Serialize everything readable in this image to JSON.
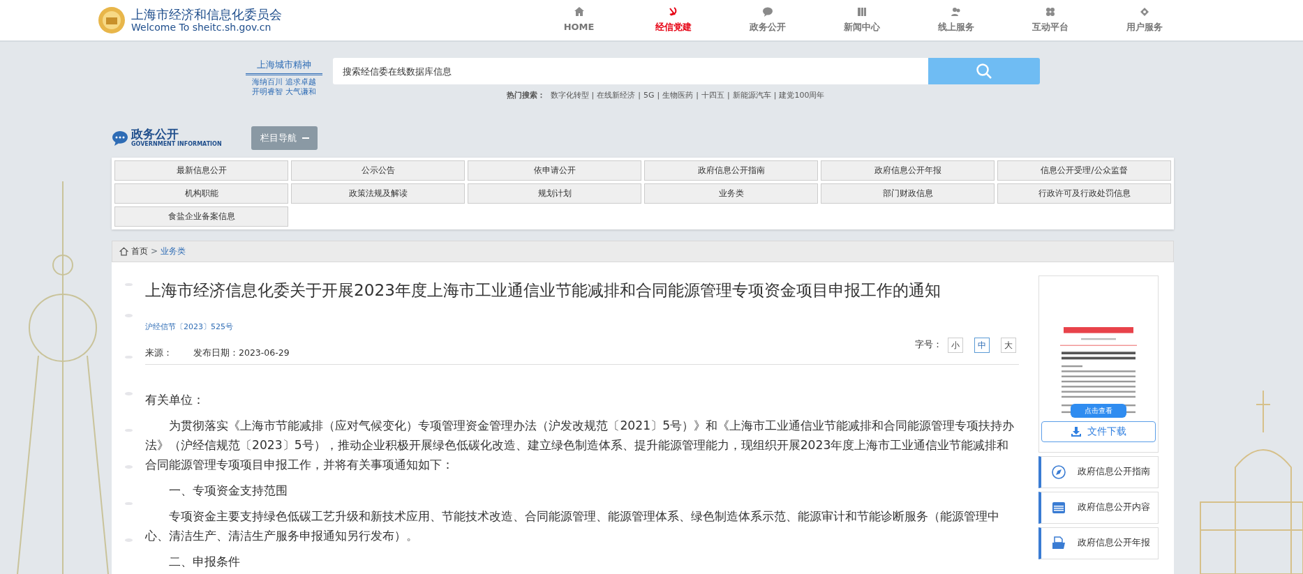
{
  "header": {
    "logo_title": "上海市经济和信息化委员会",
    "logo_subtitle": "Welcome To sheitc.sh.gov.cn",
    "nav": [
      {
        "label": "HOME",
        "selected": false
      },
      {
        "label": "经信党建",
        "selected": true
      },
      {
        "label": "政务公开",
        "selected": false
      },
      {
        "label": "新闻中心",
        "selected": false
      },
      {
        "label": "线上服务",
        "selected": false
      },
      {
        "label": "互动平台",
        "selected": false
      },
      {
        "label": "用户服务",
        "selected": false
      }
    ]
  },
  "search": {
    "motto_title": "上海城市精神",
    "motto_lines": [
      "海纳百川 追求卓越",
      "开明睿智 大气谦和"
    ],
    "placeholder": "搜索经信委在线数据库信息",
    "hot_label": "热门搜索：",
    "hot_separator": "|",
    "hot_terms": [
      "数字化转型",
      "在线新经济",
      "5G",
      "生物医药",
      "十四五",
      "新能源汽车",
      "建党100周年"
    ]
  },
  "section": {
    "title": "政务公开",
    "subtitle": "GOVERNMENT INFORMATION",
    "nav_toggle": "栏目导航"
  },
  "categories": [
    "最新信息公开",
    "公示公告",
    "依申请公开",
    "政府信息公开指南",
    "政府信息公开年报",
    "信息公开受理/公众监督",
    "机构职能",
    "政策法规及解读",
    "规划计划",
    "业务类",
    "部门财政信息",
    "行政许可及行政处罚信息",
    "食盐企业备案信息"
  ],
  "breadcrumb": {
    "items": [
      "首页",
      "业务类"
    ],
    "separator": ">"
  },
  "article": {
    "title": "上海市经济信息化委关于开展2023年度上海市工业通信业节能减排和合同能源管理专项资金项目申报工作的通知",
    "doc_number": "沪经信节〔2023〕525号",
    "source_label": "来源：",
    "date_label": "发布日期：2023-06-29",
    "font_size_label": "字号：",
    "font_sizes": [
      {
        "label": "小",
        "selected": false
      },
      {
        "label": "中",
        "selected": true
      },
      {
        "label": "大",
        "selected": false
      }
    ],
    "paragraphs": [
      {
        "kind": "salutation",
        "text": "有关单位："
      },
      {
        "kind": "body",
        "text": "为贯彻落实《上海市节能减排（应对气候变化）专项管理资金管理办法（沪发改规范〔2021〕5号）》和《上海市工业通信业节能减排和合同能源管理专项扶持办法》（沪经信规范〔2023〕5号），推动企业积极开展绿色低碳化改造、建立绿色制造体系、提升能源管理能力，现组织开展2023年度上海市工业通信业节能减排和合同能源管理专项项目申报工作，并将有关事项通知如下："
      },
      {
        "kind": "heading",
        "text": "一、专项资金支持范围"
      },
      {
        "kind": "body",
        "text": "专项资金主要支持绿色低碳工艺升级和新技术应用、节能技术改造、合同能源管理、能源管理体系、绿色制造体系示范、能源审计和节能诊断服务（能源管理中心、清洁生产、清洁生产服务申报通知另行发布）。"
      },
      {
        "kind": "heading",
        "text": "二、申报条件"
      }
    ]
  },
  "sidebar": {
    "preview_button": "点击查看",
    "download": "文件下载",
    "links": [
      {
        "label": "政府信息公开指南"
      },
      {
        "label": "政府信息公开内容"
      },
      {
        "label": "政府信息公开年报"
      }
    ]
  }
}
